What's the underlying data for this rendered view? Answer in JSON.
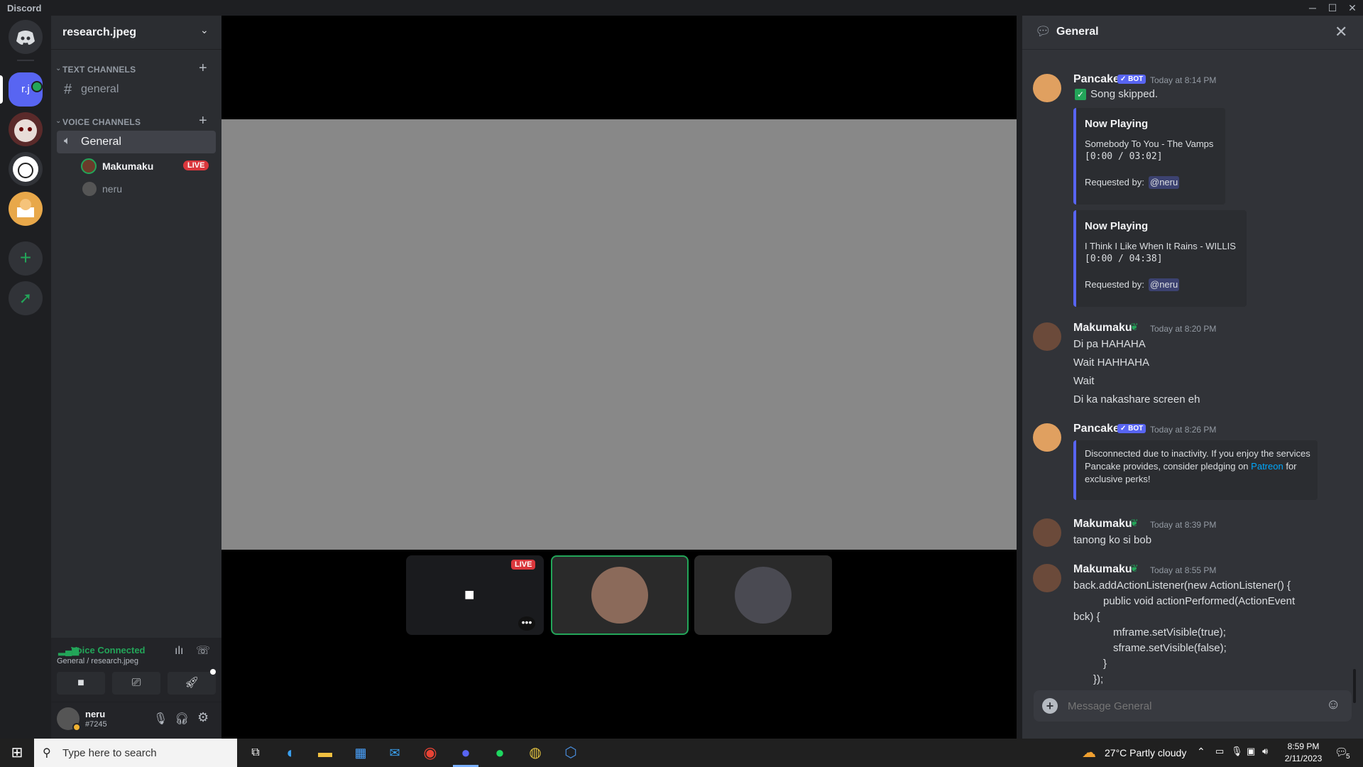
{
  "window": {
    "title": "Discord"
  },
  "server": {
    "name": "research.jpeg"
  },
  "channels": {
    "text_header": "TEXT CHANNELS",
    "text": [
      {
        "name": "general"
      }
    ],
    "voice_header": "VOICE CHANNELS",
    "voice": [
      {
        "name": "General",
        "members": [
          {
            "name": "Makumaku",
            "badge": "LIVE"
          },
          {
            "name": "neru"
          }
        ]
      }
    ]
  },
  "voice_panel": {
    "status": "Voice Connected",
    "location": "General / research.jpeg"
  },
  "user": {
    "name": "neru",
    "tag": "#7245"
  },
  "stream": {
    "live_badge": "LIVE"
  },
  "chat": {
    "channel": "General",
    "placeholder": "Message General",
    "messages": [
      {
        "author": "Pancake",
        "bot": "✓ BOT",
        "time": "Today at 8:14 PM",
        "text": "Song skipped.",
        "embeds": [
          {
            "title": "Now Playing",
            "song": "Somebody To You - The Vamps",
            "progress": "[0:00 / 03:02]",
            "req": "Requested by:",
            "mention": "@neru"
          },
          {
            "title": "Now Playing",
            "song": "I Think I Like When It Rains - WILLIS",
            "progress": "[0:00 / 04:38]",
            "req": "Requested by:",
            "mention": "@neru"
          }
        ]
      },
      {
        "author": "Makumaku",
        "time": "Today at 8:20 PM",
        "lines": [
          "Di pa HAHAHA",
          "Wait HAHHAHA",
          "Wait",
          "Di ka nakashare screen eh"
        ]
      },
      {
        "author": "Pancake",
        "bot": "✓ BOT",
        "time": "Today at 8:26 PM",
        "embed_text": "Disconnected due to inactivity. If you enjoy the services Pancake provides, consider pledging on",
        "link": "Patreon",
        "embed_tail": "for exclusive perks!"
      },
      {
        "author": "Makumaku",
        "time": "Today at 8:39 PM",
        "lines": [
          "tanong ko si bob"
        ]
      },
      {
        "author": "Makumaku",
        "time": "Today at 8:55 PM",
        "code": [
          "back.addActionListener(new ActionListener() {",
          "public void actionPerformed(ActionEvent",
          "bck) {",
          "mframe.setVisible(true);",
          "sframe.setVisible(false);",
          "}",
          "});"
        ]
      }
    ]
  },
  "taskbar": {
    "search_placeholder": "Type here to search",
    "weather": "27°C  Partly cloudy",
    "time": "8:59 PM",
    "date": "2/11/2023",
    "notifications": "5"
  }
}
